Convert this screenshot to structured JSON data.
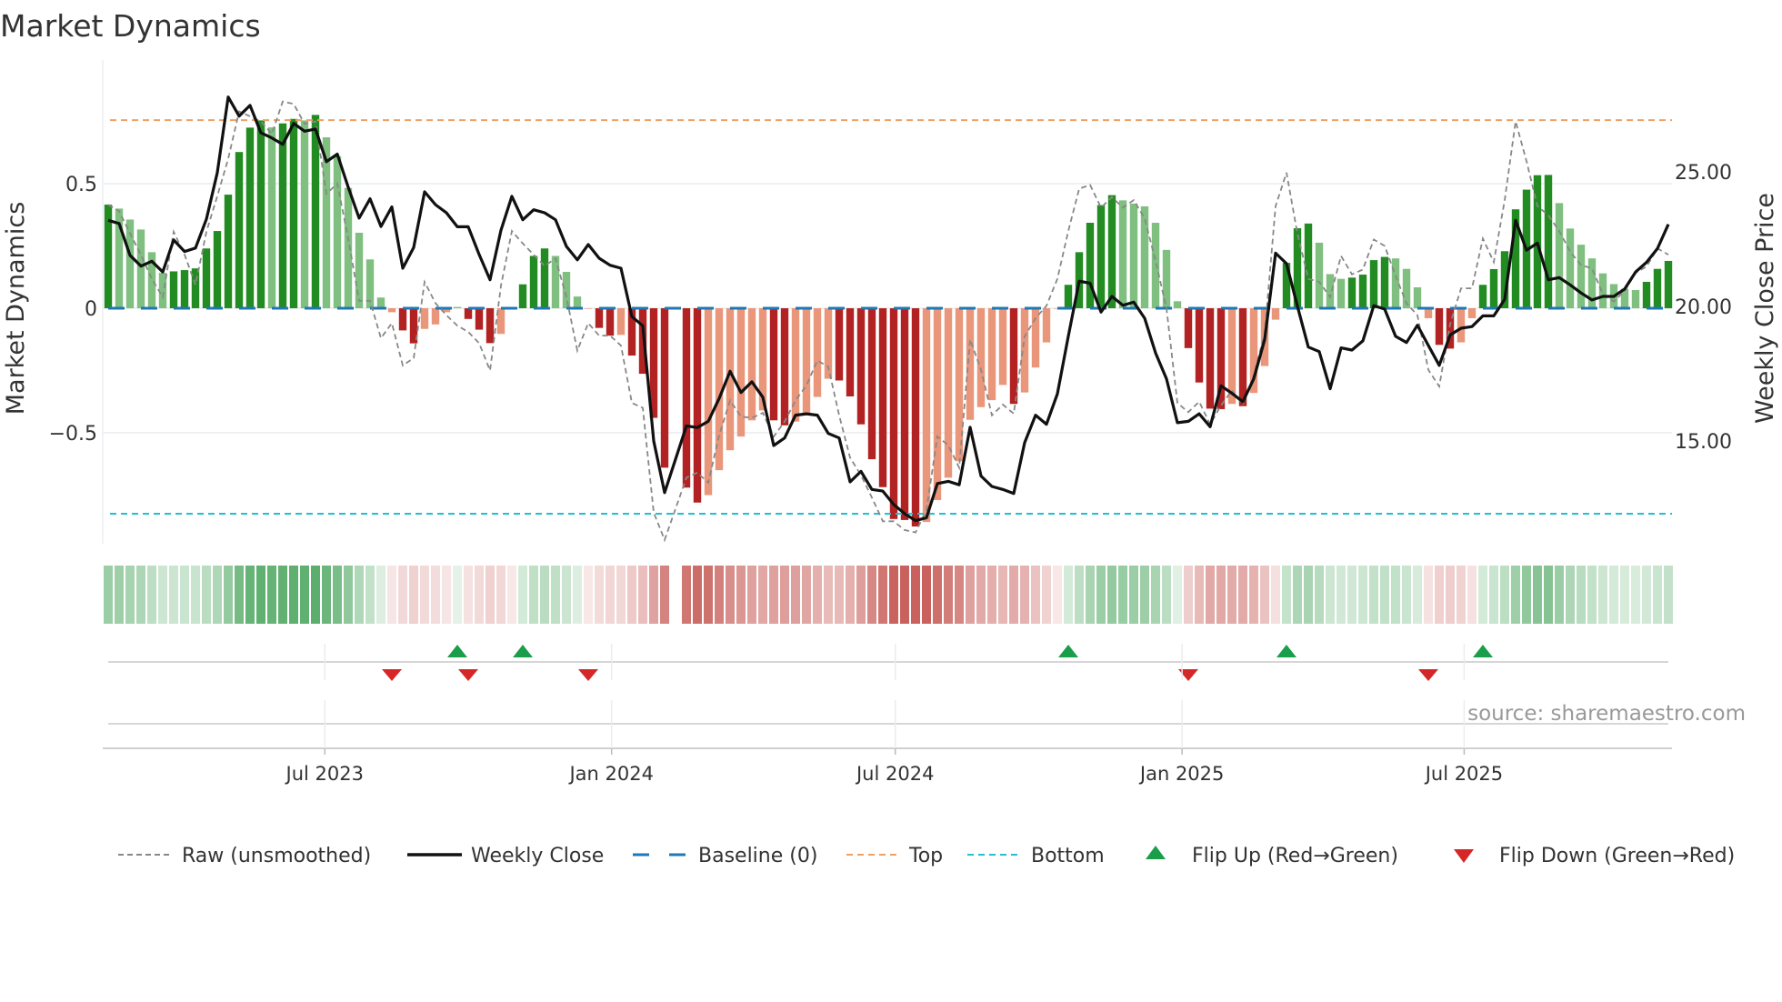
{
  "title": "Market Dynamics",
  "source": "source: sharemaestro.com",
  "colors": {
    "pos_strong": "#228b22",
    "pos_weak": "#7fbf7f",
    "neg_strong": "#b22222",
    "neg_weak": "#e9967a",
    "close": "#111111",
    "raw": "#888888",
    "baseline": "#1f77b4",
    "top": "#f0a060",
    "bottom": "#22c0d0",
    "flip_up": "#1a9e4a",
    "flip_down": "#d62728",
    "heat_pos": "#4fa862",
    "heat_neg": "#c9625e"
  },
  "chart_data": {
    "type": "bar+line",
    "title": "Market Dynamics",
    "x_type": "weekly",
    "start_week": "2023-02-12",
    "ylabel_left": "Market Dynamics",
    "ylabel_right": "Weekly Close Price",
    "ylim_left": [
      -0.955,
      0.945
    ],
    "ylim_right": [
      11.0,
      28.9
    ],
    "yticks_left": [
      {
        "v": 0.5,
        "label": "0.5"
      },
      {
        "v": 0,
        "label": "0"
      },
      {
        "v": -0.5,
        "label": "−0.5"
      }
    ],
    "yticks_right": [
      {
        "v": 25,
        "label": "25.00"
      },
      {
        "v": 20,
        "label": "20.00"
      },
      {
        "v": 15,
        "label": "15.00"
      }
    ],
    "xticks": [
      {
        "date": "2023-07-01",
        "label": "Jul 2023"
      },
      {
        "date": "2024-01-01",
        "label": "Jan 2024"
      },
      {
        "date": "2024-07-01",
        "label": "Jul 2024"
      },
      {
        "date": "2025-01-01",
        "label": "Jan 2025"
      },
      {
        "date": "2025-07-01",
        "label": "Jul 2025"
      }
    ],
    "thresholds": {
      "baseline": 0,
      "top": 0.755,
      "bottom": -0.825
    },
    "grid": true,
    "legend_position": "bottom",
    "legend": [
      {
        "key": "raw",
        "label": "Raw (unsmoothed)"
      },
      {
        "key": "close",
        "label": "Weekly Close"
      },
      {
        "key": "baseline",
        "label": "Baseline (0)"
      },
      {
        "key": "top",
        "label": "Top"
      },
      {
        "key": "bottom",
        "label": "Bottom"
      },
      {
        "key": "flip_up",
        "label": "Flip Up (Red→Green)"
      },
      {
        "key": "flip_down",
        "label": "Flip Down (Green→Red)"
      }
    ],
    "smoothed": [
      0.416,
      0.4,
      0.356,
      0.316,
      0.225,
      0.142,
      0.148,
      0.153,
      0.16,
      0.24,
      0.31,
      0.456,
      0.627,
      0.725,
      0.754,
      0.726,
      0.742,
      0.76,
      0.754,
      0.776,
      0.686,
      0.61,
      0.483,
      0.303,
      0.196,
      0.043,
      -0.016,
      -0.089,
      -0.141,
      -0.083,
      -0.065,
      -0.016,
      0.005,
      -0.043,
      -0.086,
      -0.14,
      -0.103,
      -0.005,
      0.096,
      0.21,
      0.24,
      0.21,
      0.146,
      0.047,
      -0.002,
      -0.079,
      -0.11,
      -0.107,
      -0.19,
      -0.263,
      -0.44,
      -0.64,
      null,
      -0.72,
      -0.78,
      -0.75,
      -0.65,
      -0.57,
      -0.515,
      -0.45,
      -0.41,
      -0.45,
      -0.47,
      -0.455,
      -0.42,
      -0.356,
      -0.283,
      -0.29,
      -0.354,
      -0.466,
      -0.606,
      -0.718,
      -0.846,
      -0.85,
      -0.876,
      -0.858,
      -0.77,
      -0.68,
      -0.614,
      -0.448,
      -0.397,
      -0.369,
      -0.308,
      -0.384,
      -0.338,
      -0.238,
      -0.137,
      -0.002,
      0.094,
      0.225,
      0.343,
      0.414,
      0.454,
      0.433,
      0.42,
      0.409,
      0.343,
      0.234,
      0.028,
      -0.16,
      -0.298,
      -0.403,
      -0.405,
      -0.384,
      -0.393,
      -0.34,
      -0.232,
      -0.046,
      0.182,
      0.321,
      0.34,
      0.263,
      0.137,
      0.118,
      0.123,
      0.135,
      0.193,
      0.206,
      0.2,
      0.158,
      0.084,
      -0.04,
      -0.147,
      -0.162,
      -0.137,
      -0.04,
      0.094,
      0.157,
      0.229,
      0.397,
      0.476,
      0.534,
      0.535,
      0.422,
      0.32,
      0.255,
      0.2,
      0.14,
      0.097,
      0.078,
      0.073,
      0.106,
      0.158,
      0.19
    ],
    "raw": [
      0.416,
      0.39,
      0.3,
      0.215,
      0.118,
      0.045,
      0.307,
      0.215,
      0.094,
      0.307,
      0.45,
      0.6,
      0.79,
      0.77,
      0.75,
      0.7,
      0.83,
      0.82,
      0.74,
      0.75,
      0.46,
      0.5,
      0.28,
      0.03,
      0.03,
      -0.12,
      -0.06,
      -0.23,
      -0.2,
      0.106,
      0.02,
      -0.028,
      -0.07,
      -0.095,
      -0.14,
      -0.25,
      0.09,
      0.31,
      0.26,
      0.215,
      0.17,
      0.2,
      0.045,
      -0.17,
      -0.06,
      -0.11,
      -0.11,
      -0.15,
      -0.38,
      -0.4,
      -0.82,
      -0.93,
      null,
      -0.68,
      -0.66,
      -0.7,
      -0.51,
      -0.37,
      -0.435,
      -0.44,
      -0.42,
      -0.515,
      -0.455,
      -0.37,
      -0.31,
      -0.21,
      -0.235,
      -0.43,
      -0.6,
      -0.67,
      -0.76,
      -0.855,
      -0.855,
      -0.89,
      -0.9,
      -0.81,
      -0.515,
      -0.55,
      -0.64,
      -0.125,
      -0.247,
      -0.43,
      -0.387,
      -0.423,
      -0.113,
      -0.04,
      0.01,
      0.118,
      0.31,
      0.48,
      0.495,
      0.404,
      0.446,
      0.404,
      0.434,
      0.36,
      0.19,
      0.0,
      -0.38,
      -0.417,
      -0.375,
      -0.466,
      -0.39,
      -0.33,
      -0.387,
      -0.27,
      -0.1,
      0.41,
      0.544,
      0.3,
      0.118,
      0.106,
      0.045,
      0.21,
      0.136,
      0.155,
      0.276,
      0.25,
      0.13,
      0.02,
      -0.028,
      -0.247,
      -0.314,
      -0.064,
      0.08,
      0.08,
      0.28,
      0.185,
      0.434,
      0.75,
      0.59,
      0.41,
      0.373,
      0.31,
      0.227,
      0.173,
      0.16,
      0.057,
      0.027,
      0.07,
      0.142,
      0.167,
      0.24,
      0.215
    ],
    "close": [
      23.2,
      23.08,
      21.9,
      21.5,
      21.68,
      21.28,
      22.47,
      22.04,
      22.17,
      23.24,
      24.97,
      27.78,
      27.07,
      27.47,
      26.45,
      26.26,
      26.02,
      26.8,
      26.51,
      26.59,
      25.38,
      25.66,
      24.43,
      23.28,
      24.0,
      22.97,
      23.7,
      21.42,
      22.19,
      24.26,
      23.78,
      23.48,
      22.96,
      22.96,
      21.93,
      20.99,
      22.83,
      24.09,
      23.22,
      23.59,
      23.48,
      23.22,
      22.23,
      21.73,
      22.3,
      21.79,
      21.53,
      21.42,
      19.62,
      19.28,
      15.0,
      13.08,
      null,
      15.56,
      15.5,
      15.73,
      16.58,
      17.59,
      16.8,
      17.2,
      16.63,
      14.83,
      15.11,
      15.96,
      16.01,
      15.96,
      15.28,
      15.11,
      13.48,
      13.87,
      13.2,
      13.14,
      12.64,
      12.3,
      12.04,
      12.15,
      13.42,
      13.5,
      13.37,
      15.51,
      13.7,
      13.31,
      13.2,
      13.05,
      14.94,
      15.96,
      15.62,
      16.75,
      18.89,
      20.94,
      20.86,
      19.79,
      20.37,
      20.04,
      20.16,
      19.56,
      18.27,
      17.31,
      15.68,
      15.73,
      16.01,
      15.53,
      17.05,
      16.77,
      16.46,
      17.31,
      18.77,
      21.98,
      21.59,
      20.01,
      18.49,
      18.32,
      16.94,
      18.46,
      18.38,
      18.72,
      20.03,
      19.9,
      18.89,
      18.66,
      19.3,
      18.55,
      17.81,
      18.94,
      19.19,
      19.25,
      19.65,
      19.65,
      20.26,
      23.2,
      22.09,
      22.35,
      20.99,
      21.07,
      20.8,
      20.5,
      20.24,
      20.37,
      20.37,
      20.65,
      21.28,
      21.64,
      22.15,
      23.05
    ],
    "flip_up_weeks": [
      32,
      38,
      88,
      108,
      126
    ],
    "flip_down_weeks": [
      26,
      33,
      44,
      99,
      121
    ]
  }
}
